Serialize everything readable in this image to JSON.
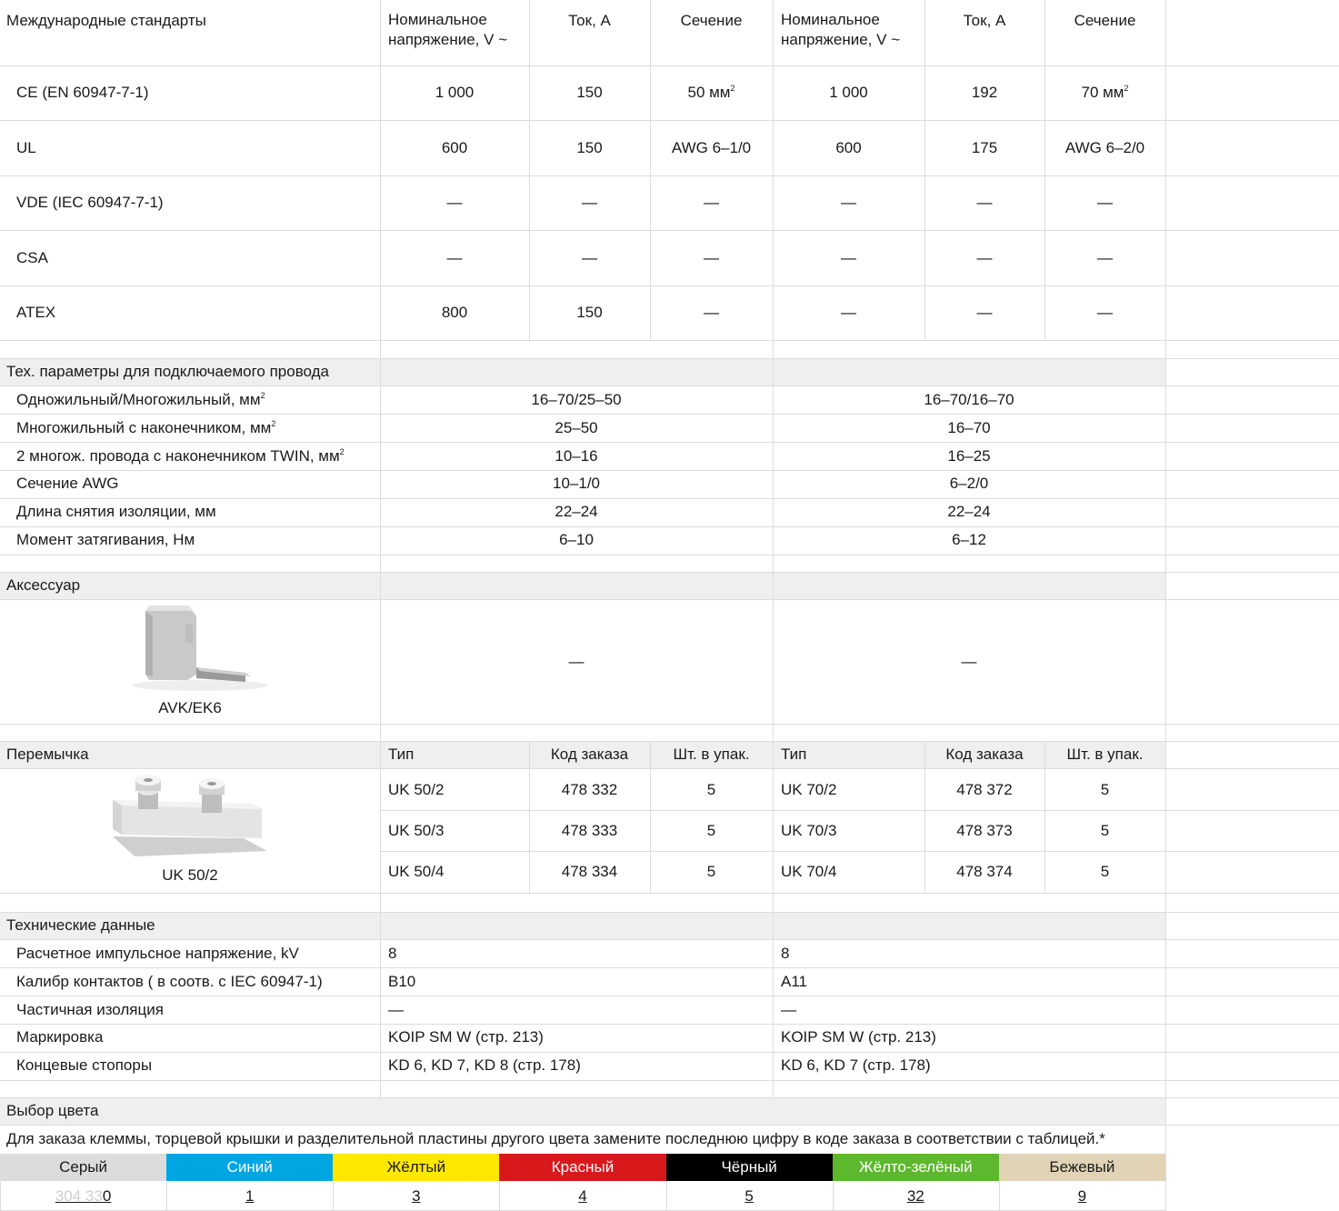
{
  "standards": {
    "header": {
      "title": "Международные стандарты",
      "voltage": "Номинальное напряжение, V ~",
      "current": "Ток, A",
      "section": "Сечение"
    },
    "rows": [
      {
        "name": "CE (EN 60947-7-1)",
        "a_v": "1 000",
        "a_i": "150",
        "a_s": "50 мм",
        "a_s_sup": "2",
        "b_v": "1 000",
        "b_i": "192",
        "b_s": "70 мм",
        "b_s_sup": "2"
      },
      {
        "name": "UL",
        "a_v": "600",
        "a_i": "150",
        "a_s": "AWG 6–1/0",
        "a_s_sup": "",
        "b_v": "600",
        "b_i": "175",
        "b_s": "AWG 6–2/0",
        "b_s_sup": ""
      },
      {
        "name": "VDE (IEC 60947-7-1)",
        "a_v": "—",
        "a_i": "—",
        "a_s": "—",
        "a_s_sup": "",
        "b_v": "—",
        "b_i": "—",
        "b_s": "—",
        "b_s_sup": ""
      },
      {
        "name": "CSA",
        "a_v": "—",
        "a_i": "—",
        "a_s": "—",
        "a_s_sup": "",
        "b_v": "—",
        "b_i": "—",
        "b_s": "—",
        "b_s_sup": ""
      },
      {
        "name": "ATEX",
        "a_v": "800",
        "a_i": "150",
        "a_s": "—",
        "a_s_sup": "",
        "b_v": "—",
        "b_i": "—",
        "b_s": "—",
        "b_s_sup": ""
      }
    ]
  },
  "wire": {
    "title": "Тех. параметры для подключаемого провода",
    "rows": [
      {
        "label": "Одножильный/Многожильный, мм",
        "sup": "2",
        "a": "16–70/25–50",
        "b": "16–70/16–70"
      },
      {
        "label": "Многожильный с наконечником, мм",
        "sup": "2",
        "a": "25–50",
        "b": "16–70"
      },
      {
        "label": "2 многож. провода с наконечником TWIN, мм",
        "sup": "2",
        "a": "10–16",
        "b": "16–25"
      },
      {
        "label": "Сечение AWG",
        "sup": "",
        "a": "10–1/0",
        "b": "6–2/0"
      },
      {
        "label": "Длина снятия изоляции, мм",
        "sup": "",
        "a": "22–24",
        "b": "22–24"
      },
      {
        "label": "Момент затягивания, Нм",
        "sup": "",
        "a": "6–10",
        "b": "6–12"
      }
    ]
  },
  "accessory": {
    "title": "Аксессуар",
    "item_label": "AVK/EK6",
    "a": "—",
    "b": "—"
  },
  "jumper": {
    "title": "Перемычка",
    "item_label": "UK 50/2",
    "header": {
      "type": "Тип",
      "code": "Код заказа",
      "qty": "Шт. в упак."
    },
    "rows": [
      {
        "a_type": "UK 50/2",
        "a_code": "478 332",
        "a_qty": "5",
        "b_type": "UK 70/2",
        "b_code": "478 372",
        "b_qty": "5"
      },
      {
        "a_type": "UK 50/3",
        "a_code": "478 333",
        "a_qty": "5",
        "b_type": "UK 70/3",
        "b_code": "478 373",
        "b_qty": "5"
      },
      {
        "a_type": "UK 50/4",
        "a_code": "478 334",
        "a_qty": "5",
        "b_type": "UK 70/4",
        "b_code": "478 374",
        "b_qty": "5"
      }
    ]
  },
  "tech": {
    "title": "Технические данные",
    "rows": [
      {
        "label": "Расчетное импульсное напряжение, kV",
        "a": "8",
        "b": "8"
      },
      {
        "label": "Калибр контактов ( в соотв. с IEC 60947-1)",
        "a": "B10",
        "b": "A11"
      },
      {
        "label": "Частичная изоляция",
        "a": "—",
        "b": "—"
      },
      {
        "label": "Маркировка",
        "a": "KOIP SM W (стр. 213)",
        "b": "KOIP SM W (стр. 213)"
      },
      {
        "label": "Концевые стопоры",
        "a": "KD 6, KD 7, KD 8 (стр. 178)",
        "b": "KD 6, KD 7 (стр. 178)"
      }
    ]
  },
  "colors": {
    "title": "Выбор цвета",
    "note": "Для заказа клеммы, торцевой крышки и разделительной пластины другого цвета замените последнюю цифру в коде заказа в соответствии с таблицей.*",
    "faint_prefix": "304  33",
    "items": [
      {
        "name": "Серый",
        "code": "0",
        "bg": "#dcdcdc",
        "fg": "#1a1a1a"
      },
      {
        "name": "Синий",
        "code": "1",
        "bg": "#00a6e2",
        "fg": "#ffffff"
      },
      {
        "name": "Жёлтый",
        "code": "3",
        "bg": "#ffe800",
        "fg": "#1a1a1a"
      },
      {
        "name": "Красный",
        "code": "4",
        "bg": "#d7191c",
        "fg": "#ffffff"
      },
      {
        "name": "Чёрный",
        "code": "5",
        "bg": "#000000",
        "fg": "#ffffff"
      },
      {
        "name": "Жёлто-зелёный",
        "code": "32",
        "bg": "#5db82e",
        "fg": "#ffffff"
      },
      {
        "name": "Бежевый",
        "code": "9",
        "bg": "#e0d3b6",
        "fg": "#1a1a1a"
      }
    ]
  }
}
